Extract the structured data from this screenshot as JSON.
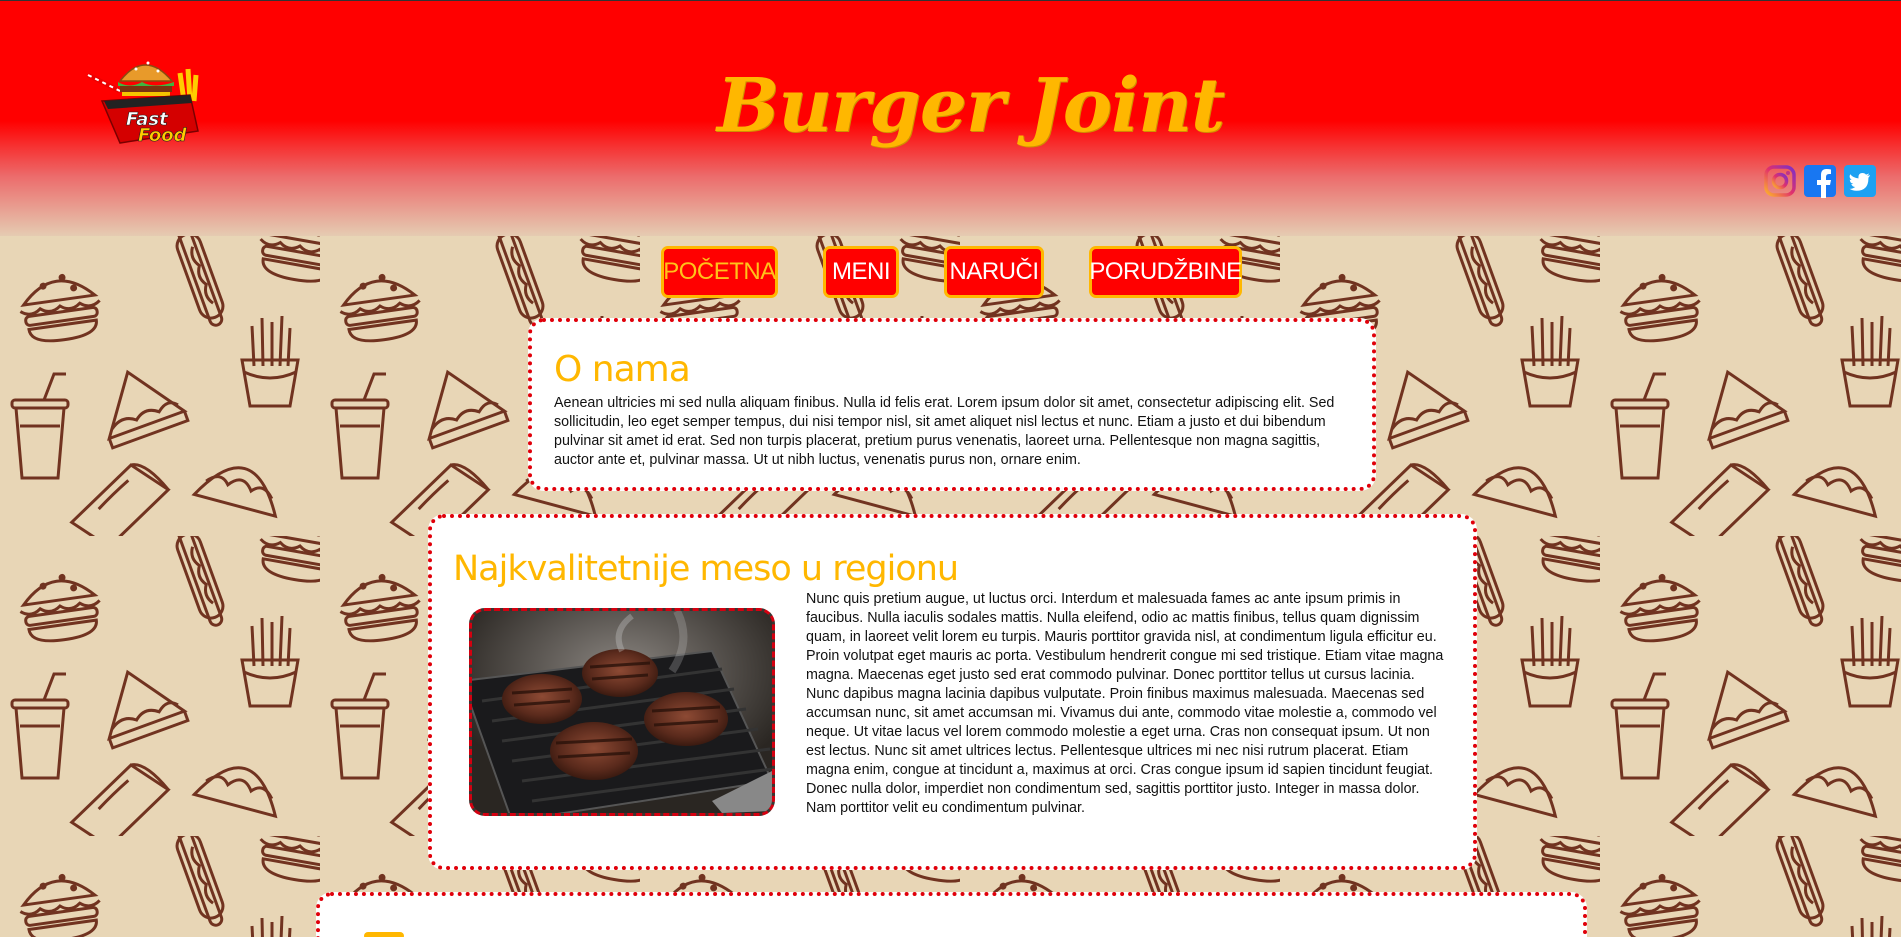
{
  "header": {
    "logo_text_line1": "Fast",
    "logo_text_line2": "Food",
    "site_title": "Burger Joint",
    "social_icons": [
      "instagram-icon",
      "facebook-icon",
      "twitter-icon"
    ]
  },
  "nav": {
    "items": [
      {
        "label": "POČETNA",
        "active": true
      },
      {
        "label": "MENI",
        "active": false
      },
      {
        "label": "NARUČI",
        "active": false
      },
      {
        "label": "PORUDŽBINE",
        "active": false
      }
    ]
  },
  "about": {
    "title": "O nama",
    "text": "Aenean ultricies mi sed nulla aliquam finibus. Nulla id felis erat. Lorem ipsum dolor sit amet, consectetur adipiscing elit. Sed sollicitudin, leo eget semper tempus, dui nisi tempor nisl, sit amet aliquet nisl lectus et nunc. Etiam a justo et dui bibendum pulvinar sit amet id erat. Sed non turpis placerat, pretium purus venenatis, laoreet urna. Pellentesque non magna sagittis, auctor ante et, pulvinar massa. Ut ut nibh luctus, venenatis purus non, ornare enim."
  },
  "meat": {
    "title": "Najkvalitetnije meso u regionu",
    "text": "Nunc quis pretium augue, ut luctus orci. Interdum et malesuada fames ac ante ipsum primis in faucibus. Nulla iaculis sodales mattis. Nulla eleifend, odio ac mattis finibus, tellus quam dignissim quam, in laoreet velit lorem eu turpis. Mauris porttitor gravida nisl, at condimentum ligula efficitur eu. Proin volutpat eget mauris ac porta. Vestibulum hendrerit congue mi sed tristique. Etiam vitae magna magna. Maecenas eget justo sed erat commodo pulvinar. Donec porttitor tellus ut cursus lacinia. Nunc dapibus magna lacinia dapibus vulputate. Proin finibus maximus malesuada. Maecenas sed accumsan nunc, sit amet accumsan mi. Vivamus dui ante, commodo vitae molestie a, commodo vel neque. Ut vitae lacus vel lorem commodo molestie a eget urna. Cras non consequat ipsum. Ut non est lectus. Nunc sit amet ultrices lectus. Pellentesque ultrices mi nec nisi rutrum placerat. Etiam magna enim, congue at tincidunt a, maximus at orci. Cras congue ipsum id sapien tincidunt feugiat. Donec nulla dolor, imperdiet non condimentum sed, sagittis porttitor justo. Integer in massa dolor. Nam porttitor velit eu condimentum pulvinar.",
    "image": "grilled-burger-patties-photo"
  },
  "colors": {
    "header_red": "#ff0000",
    "title_yellow": "#ffb700",
    "card_border_red": "#e0000a",
    "background_tan": "#e8d6b6",
    "pattern_line": "#6b2a18"
  }
}
